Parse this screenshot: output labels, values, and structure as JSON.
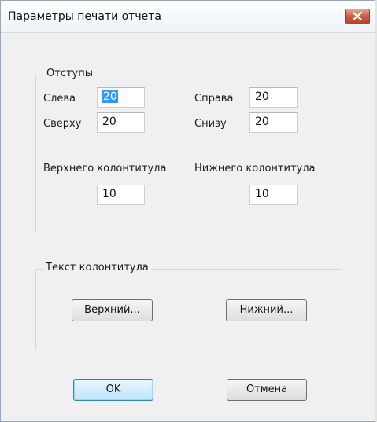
{
  "window": {
    "title": "Параметры печати отчета"
  },
  "margins": {
    "legend": "Отступы",
    "left": {
      "label": "Слева",
      "value": "20"
    },
    "right": {
      "label": "Справа",
      "value": "20"
    },
    "top": {
      "label": "Сверху",
      "value": "20"
    },
    "bottom": {
      "label": "Снизу",
      "value": "20"
    },
    "header": {
      "label": "Верхнего колонтитула",
      "value": "10"
    },
    "footer": {
      "label": "Нижнего колонтитула",
      "value": "10"
    }
  },
  "header_text": {
    "legend": "Текст колонтитула",
    "upper_button": "Верхний...",
    "lower_button": "Нижний..."
  },
  "buttons": {
    "ok": "OK",
    "cancel": "Отмена"
  },
  "colors": {
    "selection": "#3399ff",
    "close": "#c95b43"
  }
}
